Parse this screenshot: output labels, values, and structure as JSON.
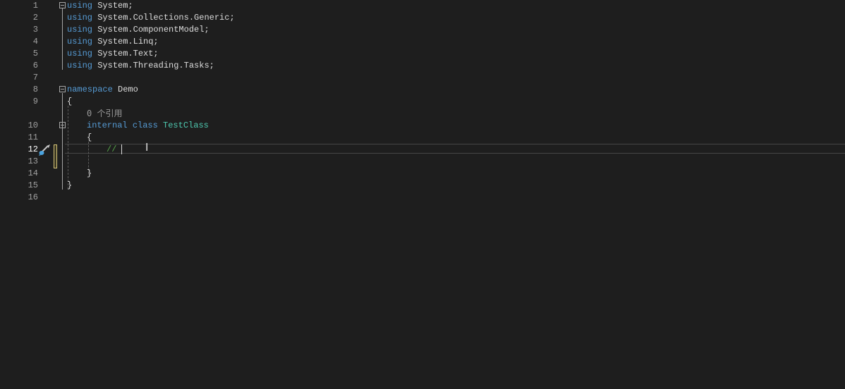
{
  "editor": {
    "lines": [
      {
        "number": "1",
        "tokens": [
          {
            "t": "using",
            "c": "kw"
          },
          {
            "t": " System;",
            "c": "txt"
          }
        ]
      },
      {
        "number": "2",
        "tokens": [
          {
            "t": "using",
            "c": "kw"
          },
          {
            "t": " System.Collections.Generic;",
            "c": "txt"
          }
        ]
      },
      {
        "number": "3",
        "tokens": [
          {
            "t": "using",
            "c": "kw"
          },
          {
            "t": " System.ComponentModel;",
            "c": "txt"
          }
        ]
      },
      {
        "number": "4",
        "tokens": [
          {
            "t": "using",
            "c": "kw"
          },
          {
            "t": " System.Linq;",
            "c": "txt"
          }
        ]
      },
      {
        "number": "5",
        "tokens": [
          {
            "t": "using",
            "c": "kw"
          },
          {
            "t": " System.Text;",
            "c": "txt"
          }
        ]
      },
      {
        "number": "6",
        "tokens": [
          {
            "t": "using",
            "c": "kw"
          },
          {
            "t": " System.Threading.Tasks;",
            "c": "txt"
          }
        ]
      },
      {
        "number": "7",
        "tokens": []
      },
      {
        "number": "8",
        "tokens": [
          {
            "t": "namespace",
            "c": "kw"
          },
          {
            "t": " Demo",
            "c": "txt"
          }
        ]
      },
      {
        "number": "9",
        "tokens": [
          {
            "t": "{",
            "c": "txt"
          }
        ]
      },
      {
        "number": "10",
        "tokens": [
          {
            "t": "internal",
            "c": "kw"
          },
          {
            "t": " ",
            "c": "txt"
          },
          {
            "t": "class",
            "c": "kw"
          },
          {
            "t": " ",
            "c": "txt"
          },
          {
            "t": "TestClass",
            "c": "cls"
          }
        ]
      },
      {
        "number": "11",
        "tokens": [
          {
            "t": "{",
            "c": "txt"
          }
        ]
      },
      {
        "number": "12",
        "tokens": [
          {
            "t": "//",
            "c": "cmt"
          }
        ]
      },
      {
        "number": "13",
        "tokens": []
      },
      {
        "number": "14",
        "tokens": [
          {
            "t": "}",
            "c": "txt"
          }
        ]
      },
      {
        "number": "15",
        "tokens": [
          {
            "t": "}",
            "c": "txt"
          }
        ]
      },
      {
        "number": "16",
        "tokens": []
      }
    ],
    "codelens": "0 个引用",
    "active_line": "12",
    "icons": {
      "quick_action": "brush-icon",
      "fold": "collapse-icon",
      "cursor": "ibeam-cursor-icon"
    },
    "colors": {
      "background": "#1e1e1e",
      "keyword": "#569cd6",
      "class": "#4ec9b0",
      "comment": "#57a64a",
      "text": "#dcdcdc",
      "change_marker": "#d7c57a"
    }
  }
}
